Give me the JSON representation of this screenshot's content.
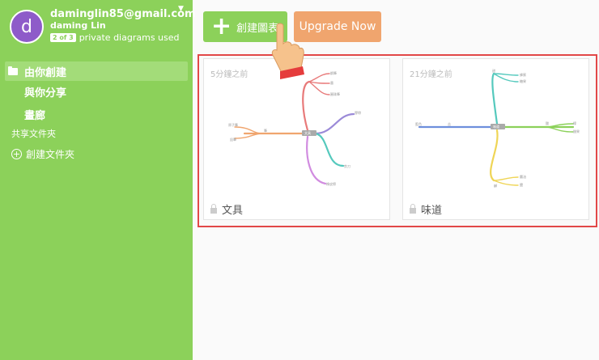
{
  "user": {
    "avatar_letter": "d",
    "email": "daminglin85@gmail.com",
    "name": "daming Lin",
    "usage_badge": "2 of 3",
    "usage_text": "private diagrams used"
  },
  "sidebar": {
    "created_by_you": "由你創建",
    "shared_with_you": "與你分享",
    "gallery": "畫廊",
    "shared_folders": "共享文件夾",
    "create_folder": "創建文件夾"
  },
  "toolbar": {
    "create_label": "創建圖表",
    "upgrade_label": "Upgrade Now"
  },
  "cards": [
    {
      "time": "5分鐘之前",
      "title": "文具"
    },
    {
      "time": "21分鐘之前",
      "title": "味道"
    }
  ]
}
